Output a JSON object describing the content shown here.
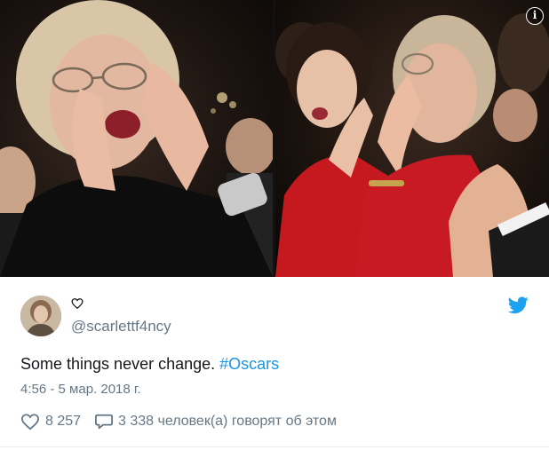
{
  "media": {
    "left_photo_alt": "",
    "right_photo_alt": "",
    "info_button_label": "i"
  },
  "user": {
    "handle": "@scarlettf4ncy"
  },
  "tweet": {
    "text_plain": "Some things never change. ",
    "hashtag": "#Oscars",
    "timestamp": "4:56 - 5 мар. 2018 г."
  },
  "actions": {
    "like_count": "8 257",
    "reply_text": "3 338 человек(а) говорят об этом"
  },
  "colors": {
    "accent": "#1b95e0",
    "muted": "#657786",
    "text": "#14171a"
  },
  "icons": {
    "heart": "heart-icon",
    "bubble": "speech-bubble-icon",
    "bird": "twitter-bird-icon",
    "info": "info-icon"
  }
}
